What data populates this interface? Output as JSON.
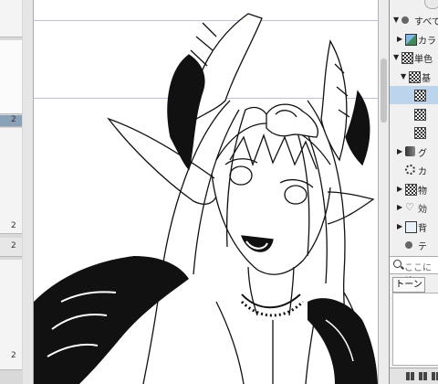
{
  "canvas_thumbnails": {
    "page_numbers": [
      "2",
      "2",
      "2",
      "2"
    ]
  },
  "material_panel": {
    "items": [
      {
        "arrow": "▼",
        "icon": "dot",
        "label": "すべて"
      },
      {
        "arrow": "▶",
        "icon": "blue",
        "label": "カラ"
      },
      {
        "arrow": "▼",
        "icon": "checker",
        "label": "単色"
      },
      {
        "arrow": "▼",
        "icon": "checker",
        "label": "基"
      },
      {
        "arrow": "",
        "icon": "checker",
        "label": "",
        "selected": true
      },
      {
        "arrow": "",
        "icon": "checker",
        "label": ""
      },
      {
        "arrow": "",
        "icon": "checker",
        "label": ""
      },
      {
        "arrow": "▶",
        "icon": "brush",
        "label": "グ"
      },
      {
        "arrow": "",
        "icon": "gear",
        "label": "カ"
      },
      {
        "arrow": "▶",
        "icon": "checker",
        "label": "物"
      },
      {
        "arrow": "▶",
        "icon": "heart",
        "label": "効"
      },
      {
        "arrow": "▶",
        "icon": "img",
        "label": "背"
      },
      {
        "arrow": "",
        "icon": "dot",
        "label": "テ"
      }
    ],
    "search_placeholder": "ここに検",
    "tab_tone": "トーン"
  }
}
